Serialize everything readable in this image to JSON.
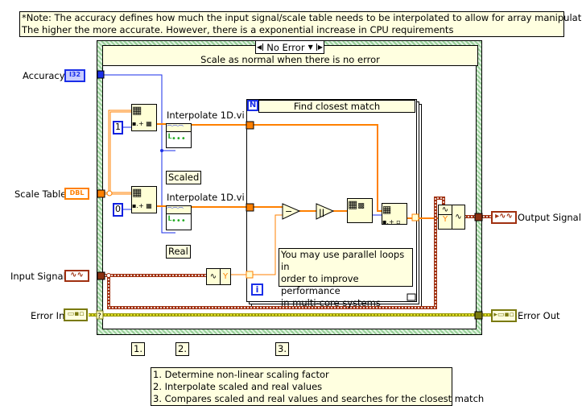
{
  "note_top": {
    "line1": "*Note: The accuracy defines how much the input signal/scale table needs to be interpolated to allow for array manipulation.",
    "line2": "The higher the more accurate. However, there is a exponential increase in CPU requirements"
  },
  "case_structure": {
    "selector_value": "No Error",
    "subdiagram_label": "Scale as normal when there is no error"
  },
  "controls": [
    {
      "label": "Accuracy",
      "type": "I32",
      "color": "#1a2ee8"
    },
    {
      "label": "Scale Table",
      "type": "DBL",
      "color": "#ff8000"
    },
    {
      "label": "Input Signal",
      "type": "waveform",
      "color": "#a03010"
    },
    {
      "label": "Error In",
      "type": "error-cluster",
      "color": "#7a7a10"
    }
  ],
  "indicators": [
    {
      "label": "Output Signal",
      "type": "waveform",
      "color": "#a03010"
    },
    {
      "label": "Error Out",
      "type": "error-cluster",
      "color": "#7a7a10"
    }
  ],
  "constants": {
    "index1": "1",
    "index0": "0"
  },
  "subvis": {
    "interp1": "Interpolate 1D.vi",
    "interp2": "Interpolate 1D.vi"
  },
  "labels": {
    "scaled": "Scaled",
    "real": "Real"
  },
  "for_loop": {
    "label": "Find closest match",
    "count_terminal": "N",
    "iteration_terminal": "i",
    "comment": [
      "You may use parallel loops in",
      "order to improve performance",
      "in multi-core systems"
    ]
  },
  "step_markers": [
    "1.",
    "2.",
    "3."
  ],
  "legend": [
    "1. Determine non-linear scaling factor",
    "2. Interpolate scaled and real values",
    "3. Compares scaled and real values and searches for the closest match"
  ],
  "colors": {
    "wire_dbl": "#ff8000",
    "wire_i32": "#1a2ee8",
    "wire_waveform": "#a03010",
    "wire_error": "#b0b000",
    "case_border": "#a8dca8",
    "note_bg": "#ffffe0"
  }
}
